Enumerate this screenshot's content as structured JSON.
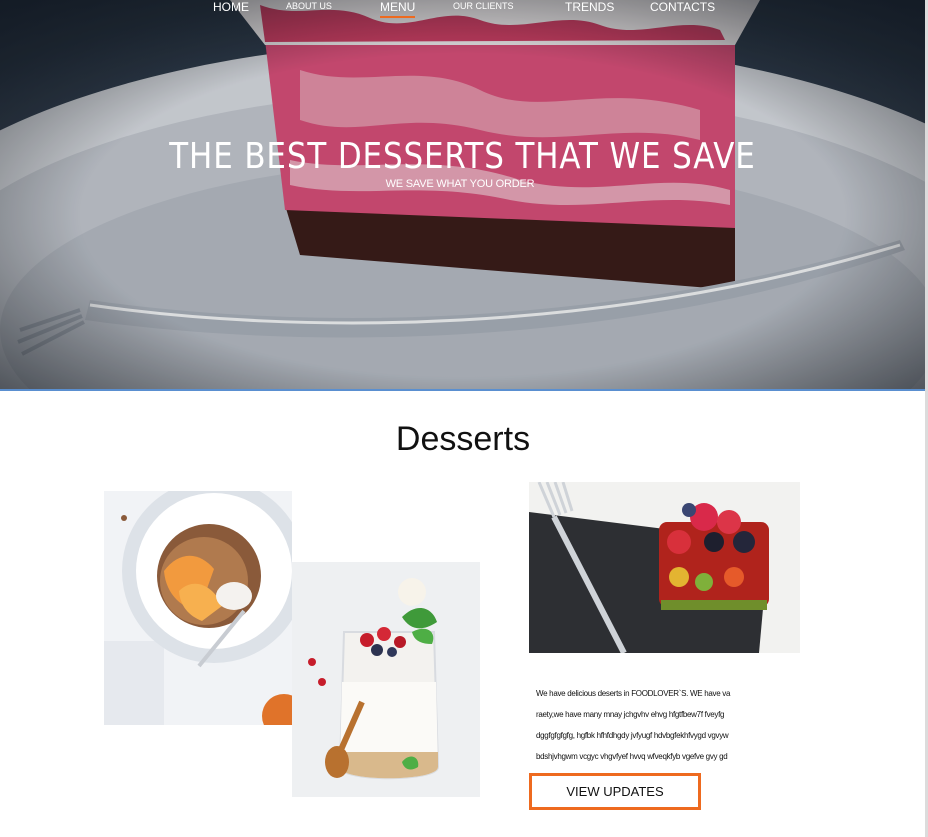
{
  "nav": {
    "items": [
      {
        "label": "HOME",
        "active": false
      },
      {
        "label": "ABOUT US",
        "active": false
      },
      {
        "label": "MENU",
        "active": true
      },
      {
        "label": "OUR CLIENTS",
        "active": false
      },
      {
        "label": "TRENDS",
        "active": false
      },
      {
        "label": "CONTACTS",
        "active": false
      }
    ]
  },
  "hero": {
    "title": "THE BEST DESSERTS THAT WE SAVE",
    "subtitle": "WE SAVE WHAT YOU ORDER"
  },
  "desserts": {
    "title": "Desserts",
    "description_lines": [
      "We have delicious deserts in FOODLOVER`S. WE have va",
      "raety,we have many mnay jchgvhv ehvg hfgtfbew7f fveyfg",
      "dggfgfgfgfg, hgfbk hfhfdhgdy jvfyugf hdvbgfekhfvygd vgvyw",
      "bdshjvhgwm  vcgyc vhgvfyef hvvq wfveqkfyb vgefve gvy gd"
    ],
    "button_label": "VIEW UPDATES"
  },
  "colors": {
    "accent": "#ee6a1f",
    "hero_overlay": "#2c3a4a"
  },
  "images": [
    "cake-slice-hero",
    "peach-granola-bowl",
    "berry-yogurt-jar",
    "fruit-tart-with-fork"
  ]
}
